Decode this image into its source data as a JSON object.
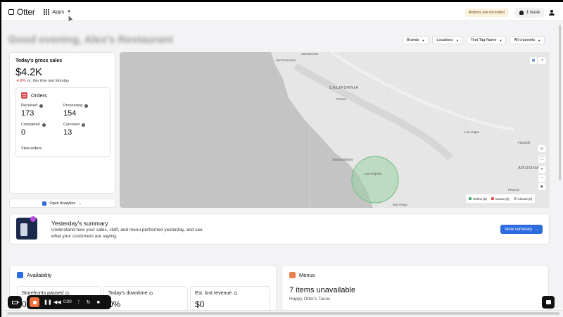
{
  "header": {
    "app_name": "Otter",
    "apps_label": "Apps",
    "recorded_badge": "Actions are recorded",
    "issue_label": "1 issue"
  },
  "page": {
    "title": "Good evening, Alex's Restaurant"
  },
  "filters": [
    "Brands",
    "Locations",
    "Test Tag Name",
    "All channels"
  ],
  "sales": {
    "title": "Today's gross sales",
    "value": "$4.2K",
    "change": "-4.9%",
    "change_suffix": "vs. this time last Monday",
    "change_color": "#d03030"
  },
  "orders": {
    "title": "Orders",
    "received_label": "Received",
    "received_value": "173",
    "processing_label": "Processing",
    "processing_value": "154",
    "completed_label": "Completed",
    "completed_value": "0",
    "canceled_label": "Canceled",
    "canceled_value": "13",
    "view_link": "View orders"
  },
  "analytics_button": "Open Analytics",
  "map": {
    "labels": {
      "san_francisco": "San Francisco",
      "california": "CALIFORNIA",
      "arizona": "ARIZONA",
      "los_angeles": "Los Angeles",
      "santa_barbara": "Santa Barbara",
      "fresno": "Fresno",
      "las_vegas": "Las Vegas",
      "sacramento": "Sacramento",
      "flagstaff": "Flagstaff",
      "phoenix": "Phoenix",
      "san_diego": "San Diego"
    },
    "legend": {
      "online": "Online (8)",
      "issues": "Issues (0)",
      "closed": "Closed (0)",
      "online_color": "#3fae5f",
      "issues_color": "#e24c4c",
      "closed_color": "#b8b8b8"
    }
  },
  "summary": {
    "title": "Yesterday's summary",
    "text": "Understand how your sales, staff, and menu performed yesterday, and see what your customers are saying.",
    "button": "View summary"
  },
  "availability": {
    "title": "Availability",
    "storefronts_label": "Storefronts paused",
    "storefronts_value": "0",
    "downtime_label": "Today's downtime",
    "downtime_value": "0%",
    "lost_label": "Est. lost revenue",
    "lost_value": "$0"
  },
  "menus": {
    "title": "Menus",
    "headline": "7 items unavailable",
    "store": "Happy Otter's Tacos"
  },
  "recorder": {
    "time": "0:00"
  }
}
